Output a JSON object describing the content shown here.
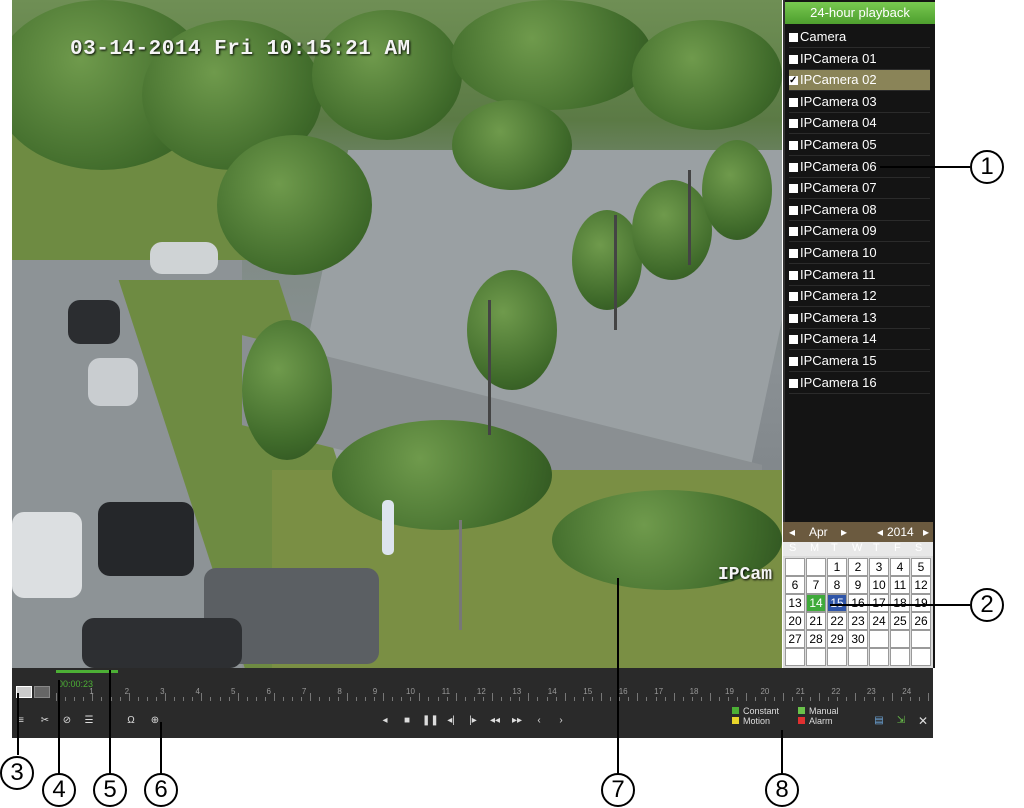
{
  "video": {
    "osd_datetime": "03-14-2014 Fri 10:15:21 AM",
    "osd_camera_label": "IPCam"
  },
  "panel": {
    "title": "24-hour playback",
    "camera_header": "Camera",
    "cameras": [
      {
        "label": "IPCamera 01",
        "checked": false
      },
      {
        "label": "IPCamera 02",
        "checked": true
      },
      {
        "label": "IPCamera 03",
        "checked": false
      },
      {
        "label": "IPCamera 04",
        "checked": false
      },
      {
        "label": "IPCamera 05",
        "checked": false
      },
      {
        "label": "IPCamera 06",
        "checked": false
      },
      {
        "label": "IPCamera 07",
        "checked": false
      },
      {
        "label": "IPCamera 08",
        "checked": false
      },
      {
        "label": "IPCamera 09",
        "checked": false
      },
      {
        "label": "IPCamera 10",
        "checked": false
      },
      {
        "label": "IPCamera 11",
        "checked": false
      },
      {
        "label": "IPCamera 12",
        "checked": false
      },
      {
        "label": "IPCamera 13",
        "checked": false
      },
      {
        "label": "IPCamera 14",
        "checked": false
      },
      {
        "label": "IPCamera 15",
        "checked": false
      },
      {
        "label": "IPCamera 16",
        "checked": false
      }
    ]
  },
  "calendar": {
    "month": "Apr",
    "year": "2014",
    "weekdays": [
      "S",
      "M",
      "T",
      "W",
      "T",
      "F",
      "S"
    ],
    "weeks": [
      [
        "",
        "",
        "1",
        "2",
        "3",
        "4",
        "5"
      ],
      [
        "6",
        "7",
        "8",
        "9",
        "10",
        "11",
        "12"
      ],
      [
        "13",
        "14",
        "15",
        "16",
        "17",
        "18",
        "19"
      ],
      [
        "20",
        "21",
        "22",
        "23",
        "24",
        "25",
        "26"
      ],
      [
        "27",
        "28",
        "29",
        "30",
        "",
        "",
        ""
      ],
      [
        "",
        "",
        "",
        "",
        "",
        "",
        ""
      ]
    ],
    "recorded_day": "14",
    "selected_day": "15"
  },
  "playback_bar": {
    "elapsed_time": "00:00:23",
    "hour_labels": [
      "1",
      "2",
      "3",
      "4",
      "5",
      "6",
      "7",
      "8",
      "9",
      "10",
      "11",
      "12",
      "13",
      "14",
      "15",
      "16",
      "17",
      "18",
      "19",
      "20",
      "21",
      "22",
      "23",
      "24"
    ],
    "legend": [
      {
        "label": "Constant",
        "color": "#4caf35"
      },
      {
        "label": "Manual",
        "color": "#6ac24a"
      },
      {
        "label": "Motion",
        "color": "#e8d52a"
      },
      {
        "label": "Alarm",
        "color": "#e03030"
      }
    ]
  },
  "callouts": [
    "1",
    "2",
    "3",
    "4",
    "5",
    "6",
    "7",
    "8"
  ]
}
